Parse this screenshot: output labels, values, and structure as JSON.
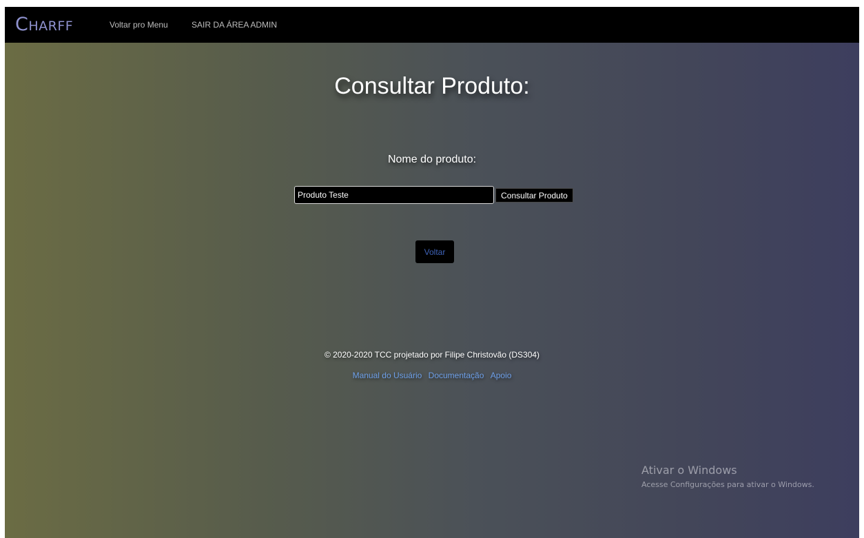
{
  "navbar": {
    "brand": "Charff",
    "menu_link": "Voltar pro Menu",
    "admin_exit_link": "SAIR DA ÁREA ADMIN"
  },
  "main": {
    "title": "Consultar Produto:",
    "field_label": "Nome do produto:",
    "search_value": "Produto Teste",
    "search_button": "Consultar Produto",
    "back_button": "Voltar"
  },
  "footer": {
    "copyright": "© 2020-2020 TCC projetado por Filipe Christovão (DS304)",
    "links": [
      "Manual do Usuário",
      "Documentação",
      "Apoio"
    ]
  },
  "watermark": {
    "title": "Ativar o Windows",
    "subtitle": "Acesse Configurações para ativar o Windows."
  },
  "colors": {
    "navbar_bg": "#000000",
    "brand": "#8f92cf",
    "footer_link": "#6d9fe8",
    "back_button_text": "#3f63b8"
  }
}
